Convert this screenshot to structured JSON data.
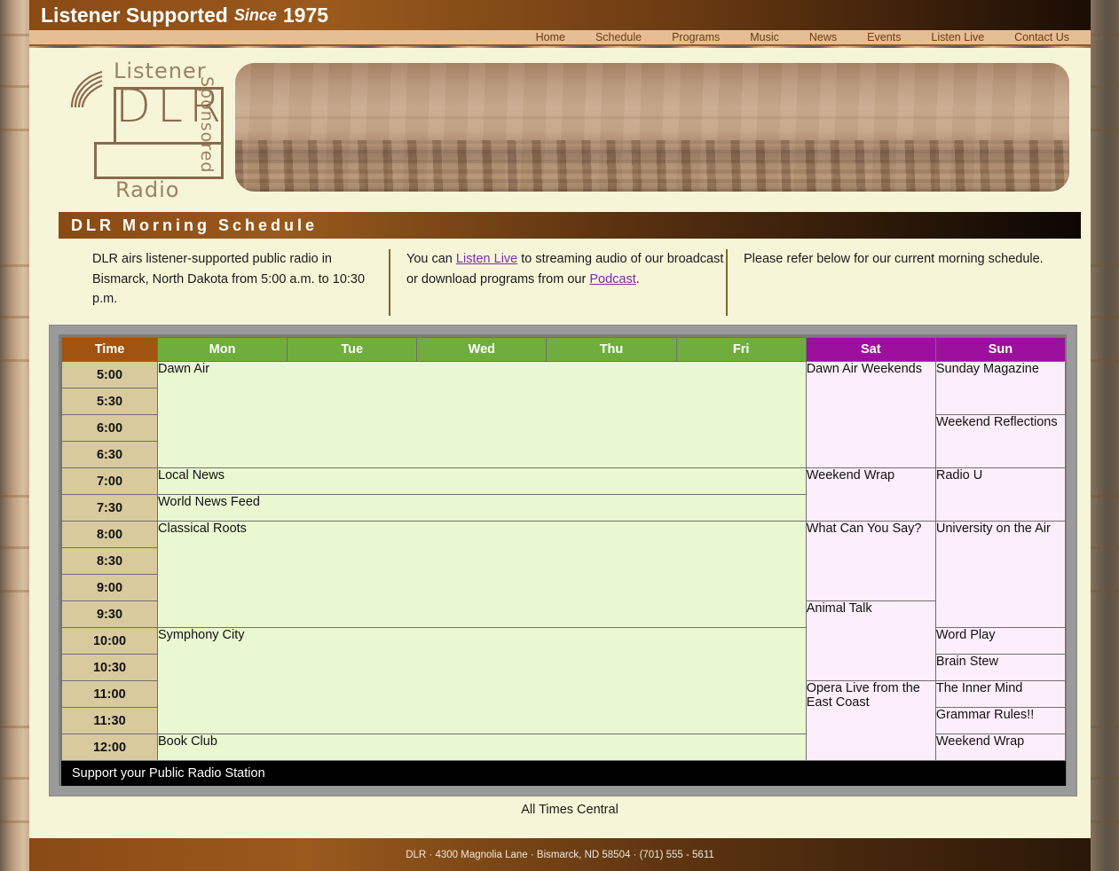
{
  "header": {
    "title_main": "Listener Supported",
    "title_since": "Since",
    "title_year": "1975"
  },
  "nav": {
    "items": [
      {
        "label": "Home"
      },
      {
        "label": "Schedule"
      },
      {
        "label": "Programs"
      },
      {
        "label": "Music"
      },
      {
        "label": "News"
      },
      {
        "label": "Events"
      },
      {
        "label": "Listen Live"
      },
      {
        "label": "Contact Us"
      }
    ]
  },
  "logo": {
    "listener": "Listener",
    "acronym": "DLR",
    "sponsored": "Sponsored",
    "radio": "Radio"
  },
  "section": {
    "banner_title": "DLR Morning Schedule"
  },
  "intro": {
    "col1": "DLR airs listener-supported public radio in Bismarck, North Dakota from 5:00 a.m. to 10:30 p.m.",
    "col2_pre": "You can ",
    "col2_link1": "Listen Live",
    "col2_mid": " to streaming audio of our broadcast or download programs from our ",
    "col2_link2": "Podcast",
    "col2_post": ".",
    "col3": "Please refer below for our current morning schedule."
  },
  "schedule": {
    "columns": [
      "Time",
      "Mon",
      "Tue",
      "Wed",
      "Thu",
      "Fri",
      "Sat",
      "Sun"
    ],
    "times": [
      "5:00",
      "5:30",
      "6:00",
      "6:30",
      "7:00",
      "7:30",
      "8:00",
      "8:30",
      "9:00",
      "9:30",
      "10:00",
      "10:30",
      "11:00",
      "11:30",
      "12:00"
    ],
    "weekday_programs": [
      {
        "name": "Dawn Air",
        "start": "5:00",
        "rows": 4
      },
      {
        "name": "Local News",
        "start": "7:00",
        "rows": 1
      },
      {
        "name": "World News Feed",
        "start": "7:30",
        "rows": 1
      },
      {
        "name": "Classical Roots",
        "start": "8:00",
        "rows": 4
      },
      {
        "name": "Symphony City",
        "start": "10:00",
        "rows": 4
      },
      {
        "name": "Book Club",
        "start": "12:00",
        "rows": 1
      }
    ],
    "saturday_programs": [
      {
        "name": "Dawn Air Weekends",
        "start": "5:00",
        "rows": 4
      },
      {
        "name": "Weekend Wrap",
        "start": "7:00",
        "rows": 2
      },
      {
        "name": "What Can You Say?",
        "start": "8:00",
        "rows": 3
      },
      {
        "name": "Animal Talk",
        "start": "9:30",
        "rows": 3
      },
      {
        "name": "Opera Live from the East Coast",
        "start": "11:00",
        "rows": 3
      }
    ],
    "sunday_programs": [
      {
        "name": "Sunday Magazine",
        "start": "5:00",
        "rows": 2
      },
      {
        "name": "Weekend Reflections",
        "start": "6:00",
        "rows": 2
      },
      {
        "name": "Radio U",
        "start": "7:00",
        "rows": 2
      },
      {
        "name": "University on the Air",
        "start": "8:00",
        "rows": 4
      },
      {
        "name": "Word Play",
        "start": "10:00",
        "rows": 1
      },
      {
        "name": "Brain Stew",
        "start": "10:30",
        "rows": 1
      },
      {
        "name": "The Inner Mind",
        "start": "11:00",
        "rows": 1
      },
      {
        "name": "Grammar Rules!!",
        "start": "11:30",
        "rows": 1
      },
      {
        "name": "Weekend Wrap",
        "start": "12:00",
        "rows": 1
      }
    ],
    "caption": "Support your Public Radio Station"
  },
  "all_times_note": "All Times Central",
  "footer": {
    "text": "DLR · 4300 Magnolia Lane · Bismarck, ND 58504 · (701) 555 - 5611"
  },
  "colors": {
    "brand_brown": "#9a5a1c",
    "nav_bg": "#e6be95",
    "page_cream": "#f7f5d8",
    "weekday_header": "#6fae3e",
    "weekend_header": "#9d109d",
    "time_header": "#a0540f",
    "time_cell": "#d9ca9e",
    "weekday_cell": "#eaf8d2",
    "weekend_cell": "#fdeefb",
    "link": "#7a2ea8"
  }
}
